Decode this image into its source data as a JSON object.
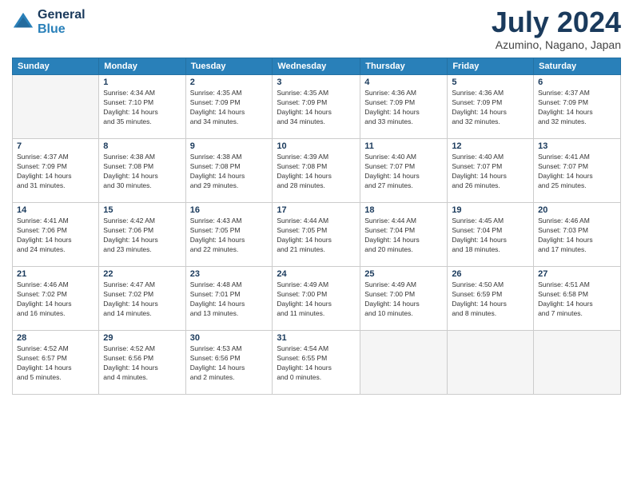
{
  "header": {
    "logo_line1": "General",
    "logo_line2": "Blue",
    "month": "July 2024",
    "location": "Azumino, Nagano, Japan"
  },
  "weekdays": [
    "Sunday",
    "Monday",
    "Tuesday",
    "Wednesday",
    "Thursday",
    "Friday",
    "Saturday"
  ],
  "weeks": [
    [
      {
        "day": "",
        "info": ""
      },
      {
        "day": "1",
        "info": "Sunrise: 4:34 AM\nSunset: 7:10 PM\nDaylight: 14 hours\nand 35 minutes."
      },
      {
        "day": "2",
        "info": "Sunrise: 4:35 AM\nSunset: 7:09 PM\nDaylight: 14 hours\nand 34 minutes."
      },
      {
        "day": "3",
        "info": "Sunrise: 4:35 AM\nSunset: 7:09 PM\nDaylight: 14 hours\nand 34 minutes."
      },
      {
        "day": "4",
        "info": "Sunrise: 4:36 AM\nSunset: 7:09 PM\nDaylight: 14 hours\nand 33 minutes."
      },
      {
        "day": "5",
        "info": "Sunrise: 4:36 AM\nSunset: 7:09 PM\nDaylight: 14 hours\nand 32 minutes."
      },
      {
        "day": "6",
        "info": "Sunrise: 4:37 AM\nSunset: 7:09 PM\nDaylight: 14 hours\nand 32 minutes."
      }
    ],
    [
      {
        "day": "7",
        "info": "Sunrise: 4:37 AM\nSunset: 7:09 PM\nDaylight: 14 hours\nand 31 minutes."
      },
      {
        "day": "8",
        "info": "Sunrise: 4:38 AM\nSunset: 7:08 PM\nDaylight: 14 hours\nand 30 minutes."
      },
      {
        "day": "9",
        "info": "Sunrise: 4:38 AM\nSunset: 7:08 PM\nDaylight: 14 hours\nand 29 minutes."
      },
      {
        "day": "10",
        "info": "Sunrise: 4:39 AM\nSunset: 7:08 PM\nDaylight: 14 hours\nand 28 minutes."
      },
      {
        "day": "11",
        "info": "Sunrise: 4:40 AM\nSunset: 7:07 PM\nDaylight: 14 hours\nand 27 minutes."
      },
      {
        "day": "12",
        "info": "Sunrise: 4:40 AM\nSunset: 7:07 PM\nDaylight: 14 hours\nand 26 minutes."
      },
      {
        "day": "13",
        "info": "Sunrise: 4:41 AM\nSunset: 7:07 PM\nDaylight: 14 hours\nand 25 minutes."
      }
    ],
    [
      {
        "day": "14",
        "info": "Sunrise: 4:41 AM\nSunset: 7:06 PM\nDaylight: 14 hours\nand 24 minutes."
      },
      {
        "day": "15",
        "info": "Sunrise: 4:42 AM\nSunset: 7:06 PM\nDaylight: 14 hours\nand 23 minutes."
      },
      {
        "day": "16",
        "info": "Sunrise: 4:43 AM\nSunset: 7:05 PM\nDaylight: 14 hours\nand 22 minutes."
      },
      {
        "day": "17",
        "info": "Sunrise: 4:44 AM\nSunset: 7:05 PM\nDaylight: 14 hours\nand 21 minutes."
      },
      {
        "day": "18",
        "info": "Sunrise: 4:44 AM\nSunset: 7:04 PM\nDaylight: 14 hours\nand 20 minutes."
      },
      {
        "day": "19",
        "info": "Sunrise: 4:45 AM\nSunset: 7:04 PM\nDaylight: 14 hours\nand 18 minutes."
      },
      {
        "day": "20",
        "info": "Sunrise: 4:46 AM\nSunset: 7:03 PM\nDaylight: 14 hours\nand 17 minutes."
      }
    ],
    [
      {
        "day": "21",
        "info": "Sunrise: 4:46 AM\nSunset: 7:02 PM\nDaylight: 14 hours\nand 16 minutes."
      },
      {
        "day": "22",
        "info": "Sunrise: 4:47 AM\nSunset: 7:02 PM\nDaylight: 14 hours\nand 14 minutes."
      },
      {
        "day": "23",
        "info": "Sunrise: 4:48 AM\nSunset: 7:01 PM\nDaylight: 14 hours\nand 13 minutes."
      },
      {
        "day": "24",
        "info": "Sunrise: 4:49 AM\nSunset: 7:00 PM\nDaylight: 14 hours\nand 11 minutes."
      },
      {
        "day": "25",
        "info": "Sunrise: 4:49 AM\nSunset: 7:00 PM\nDaylight: 14 hours\nand 10 minutes."
      },
      {
        "day": "26",
        "info": "Sunrise: 4:50 AM\nSunset: 6:59 PM\nDaylight: 14 hours\nand 8 minutes."
      },
      {
        "day": "27",
        "info": "Sunrise: 4:51 AM\nSunset: 6:58 PM\nDaylight: 14 hours\nand 7 minutes."
      }
    ],
    [
      {
        "day": "28",
        "info": "Sunrise: 4:52 AM\nSunset: 6:57 PM\nDaylight: 14 hours\nand 5 minutes."
      },
      {
        "day": "29",
        "info": "Sunrise: 4:52 AM\nSunset: 6:56 PM\nDaylight: 14 hours\nand 4 minutes."
      },
      {
        "day": "30",
        "info": "Sunrise: 4:53 AM\nSunset: 6:56 PM\nDaylight: 14 hours\nand 2 minutes."
      },
      {
        "day": "31",
        "info": "Sunrise: 4:54 AM\nSunset: 6:55 PM\nDaylight: 14 hours\nand 0 minutes."
      },
      {
        "day": "",
        "info": ""
      },
      {
        "day": "",
        "info": ""
      },
      {
        "day": "",
        "info": ""
      }
    ]
  ]
}
